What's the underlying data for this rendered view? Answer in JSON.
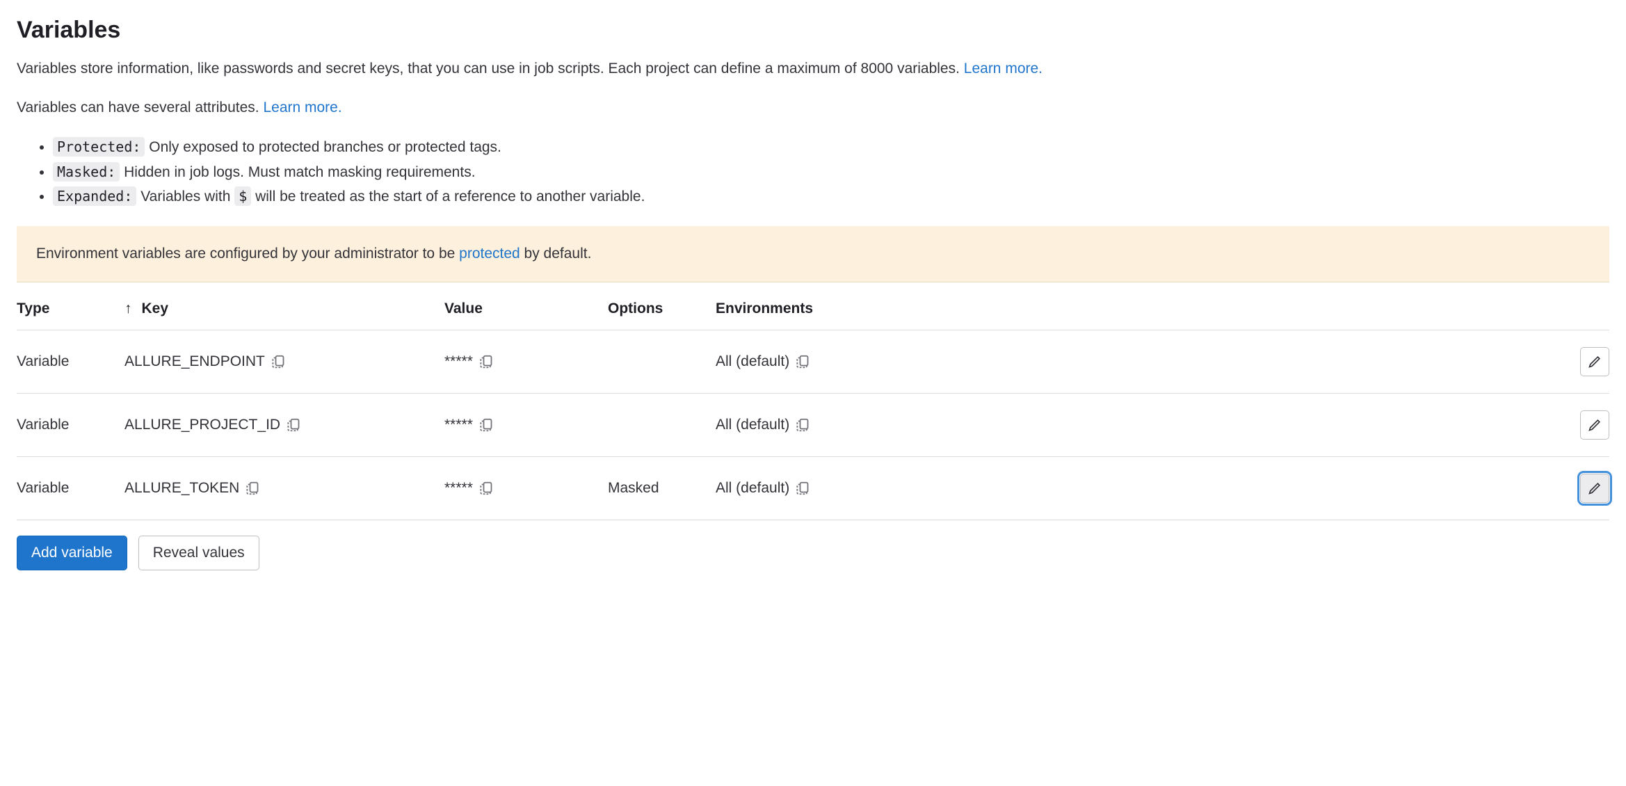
{
  "header": {
    "title": "Variables",
    "description": "Variables store information, like passwords and secret keys, that you can use in job scripts. Each project can define a maximum of 8000 variables. ",
    "learn_more": "Learn more.",
    "attributes_intro": "Variables can have several attributes. ",
    "attributes_learn_more": "Learn more."
  },
  "attributes": [
    {
      "tag": "Protected:",
      "text": " Only exposed to protected branches or protected tags."
    },
    {
      "tag": "Masked:",
      "text": " Hidden in job logs. Must match masking requirements."
    },
    {
      "tag": "Expanded:",
      "text_before": " Variables with ",
      "dollar": "$",
      "text_after": " will be treated as the start of a reference to another variable."
    }
  ],
  "banner": {
    "prefix": "Environment variables are configured by your administrator to be ",
    "link": "protected",
    "suffix": " by default."
  },
  "table": {
    "headers": {
      "type": "Type",
      "key": "Key",
      "value": "Value",
      "options": "Options",
      "environments": "Environments"
    },
    "sort_arrow": "↑",
    "rows": [
      {
        "type": "Variable",
        "key": "ALLURE_ENDPOINT",
        "value": "*****",
        "options": "",
        "env": "All (default)"
      },
      {
        "type": "Variable",
        "key": "ALLURE_PROJECT_ID",
        "value": "*****",
        "options": "",
        "env": "All (default)"
      },
      {
        "type": "Variable",
        "key": "ALLURE_TOKEN",
        "value": "*****",
        "options": "Masked",
        "env": "All (default)"
      }
    ]
  },
  "buttons": {
    "add_variable": "Add variable",
    "reveal_values": "Reveal values"
  }
}
